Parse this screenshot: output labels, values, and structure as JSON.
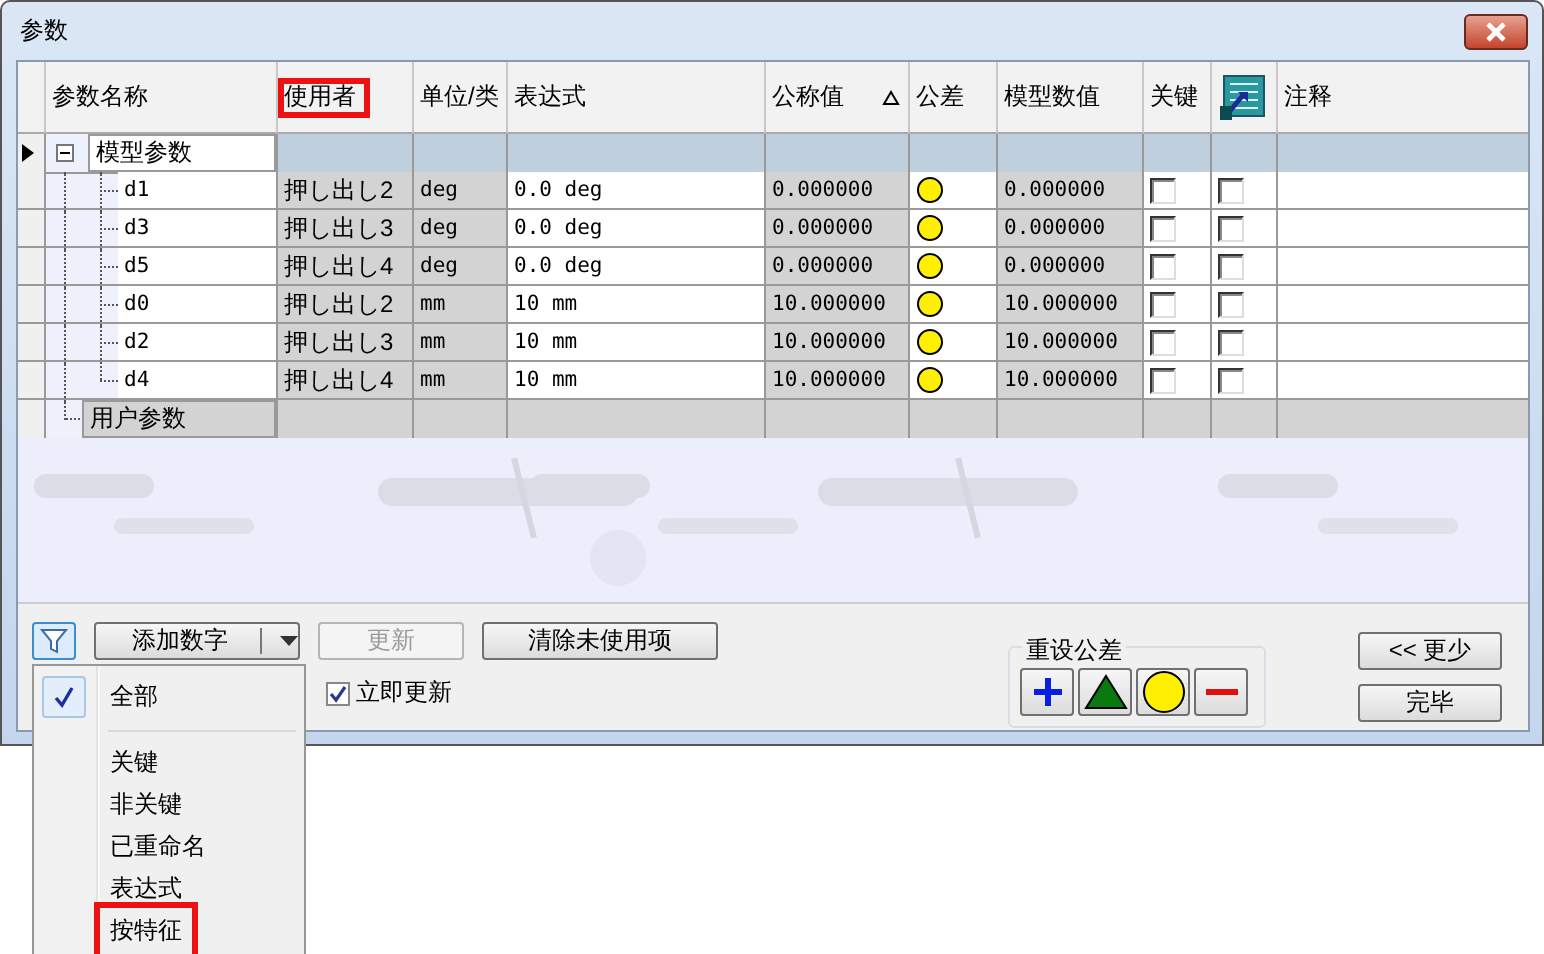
{
  "window": {
    "title": "参数"
  },
  "table": {
    "columns": [
      {
        "label": "参数名称",
        "highlighted": false,
        "sorted": false
      },
      {
        "label": "使用者",
        "highlighted": true,
        "sorted": false
      },
      {
        "label": "单位/类",
        "highlighted": false,
        "sorted": false
      },
      {
        "label": "表达式",
        "highlighted": false,
        "sorted": false
      },
      {
        "label": "公称值",
        "highlighted": false,
        "sorted": true
      },
      {
        "label": "公差",
        "highlighted": false,
        "sorted": false
      },
      {
        "label": "模型数值",
        "highlighted": false,
        "sorted": false
      },
      {
        "label": "关键",
        "highlighted": false,
        "sorted": false
      },
      {
        "kind": "icon",
        "highlighted": false,
        "sorted": false
      },
      {
        "label": "注释",
        "highlighted": false,
        "sorted": false
      }
    ],
    "groups": [
      {
        "name": "模型参数",
        "expanded": true,
        "current": true,
        "children": [
          {
            "name": "d1",
            "used_by": "押し出し2",
            "unit": "deg",
            "expression": "0.0 deg",
            "nominal": "0.000000",
            "tolerance": {
              "kind": "nominal"
            },
            "model_value": "0.000000",
            "key": false,
            "column_9": false
          },
          {
            "name": "d3",
            "used_by": "押し出し3",
            "unit": "deg",
            "expression": "0.0 deg",
            "nominal": "0.000000",
            "tolerance": {
              "kind": "nominal"
            },
            "model_value": "0.000000",
            "key": false,
            "column_9": false
          },
          {
            "name": "d5",
            "used_by": "押し出し4",
            "unit": "deg",
            "expression": "0.0 deg",
            "nominal": "0.000000",
            "tolerance": {
              "kind": "nominal"
            },
            "model_value": "0.000000",
            "key": false,
            "column_9": false
          },
          {
            "name": "d0",
            "used_by": "押し出し2",
            "unit": "mm",
            "expression": "10 mm",
            "nominal": "10.000000",
            "tolerance": {
              "kind": "nominal"
            },
            "model_value": "10.000000",
            "key": false,
            "column_9": false
          },
          {
            "name": "d2",
            "used_by": "押し出し3",
            "unit": "mm",
            "expression": "10 mm",
            "nominal": "10.000000",
            "tolerance": {
              "kind": "nominal"
            },
            "model_value": "10.000000",
            "key": false,
            "column_9": false
          },
          {
            "name": "d4",
            "used_by": "押し出し4",
            "unit": "mm",
            "expression": "10 mm",
            "nominal": "10.000000",
            "tolerance": {
              "kind": "nominal"
            },
            "model_value": "10.000000",
            "key": false,
            "column_9": false
          }
        ]
      },
      {
        "name": "用户参数",
        "current": false
      }
    ]
  },
  "footer": {
    "add_button": "添加数字",
    "update_button": {
      "label": "更新",
      "disabled": true
    },
    "purge_button": "清除未使用项",
    "immediate_update": {
      "label": "立即更新",
      "checked": true
    },
    "reset_tolerance": {
      "label": "重设公差",
      "buttons": [
        {
          "kind": "plus"
        },
        {
          "kind": "upper"
        },
        {
          "kind": "nominal"
        },
        {
          "kind": "minus"
        }
      ]
    },
    "less_button": "<< 更少",
    "done_button": "完毕"
  },
  "filter_menu": {
    "items": [
      {
        "kind": "item",
        "label": "全部",
        "checked": true,
        "highlighted": false
      },
      {
        "kind": "separator"
      },
      {
        "kind": "item",
        "label": "关键",
        "checked": false,
        "highlighted": false
      },
      {
        "kind": "item",
        "label": "非关键",
        "checked": false,
        "highlighted": false
      },
      {
        "kind": "item",
        "label": "已重命名",
        "checked": false,
        "highlighted": false
      },
      {
        "kind": "item",
        "label": "表达式",
        "checked": false,
        "highlighted": false
      },
      {
        "kind": "item",
        "label": "按特征",
        "checked": false,
        "highlighted": true
      }
    ]
  }
}
